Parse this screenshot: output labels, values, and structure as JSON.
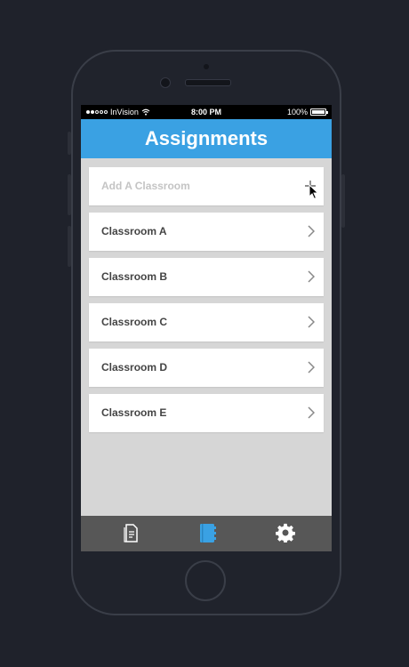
{
  "status_bar": {
    "carrier": "InVision",
    "time": "8:00 PM",
    "battery": "100%"
  },
  "header": {
    "title": "Assignments"
  },
  "list": {
    "add_label": "Add A Classroom",
    "items": [
      {
        "label": "Classroom A"
      },
      {
        "label": "Classroom B"
      },
      {
        "label": "Classroom C"
      },
      {
        "label": "Classroom D"
      },
      {
        "label": "Classroom E"
      }
    ]
  },
  "tab_bar": {
    "tabs": [
      {
        "icon": "document-icon",
        "active": false
      },
      {
        "icon": "notebook-icon",
        "active": true
      },
      {
        "icon": "gear-icon",
        "active": false
      }
    ]
  },
  "colors": {
    "accent": "#3aa1e3",
    "background": "#d6d6d6",
    "tab_bar": "#575757",
    "page_bg": "#1f222b"
  }
}
